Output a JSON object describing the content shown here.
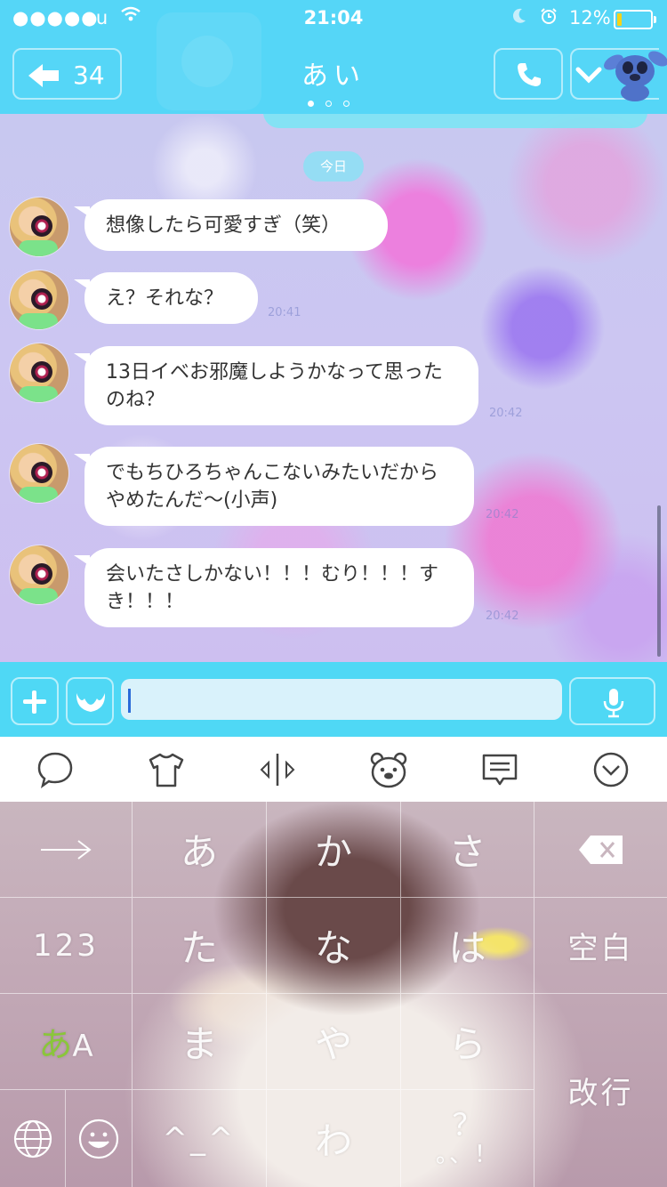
{
  "status_bar": {
    "signal": "●●●●●",
    "carrier": "au",
    "time": "21:04",
    "battery_percent": "12%",
    "battery_level": 0.12,
    "battery_color": "#f5d21a"
  },
  "header": {
    "back_count": "34",
    "title": "あい",
    "page_dots": 3,
    "active_dot": 0,
    "background": "#55d6f7"
  },
  "chat": {
    "date_label": "今日",
    "messages": [
      {
        "text": "想像したら可愛すぎ（笑）",
        "time": ""
      },
      {
        "text": "え？それな？",
        "time": "20:41"
      },
      {
        "text": "13日イベお邪魔しようかなって思ったのね？",
        "time": "20:42"
      },
      {
        "text": "でもちひろちゃんこないみたいだからやめたんだ〜(小声)",
        "time": "20:42"
      },
      {
        "text": "会いたさしかない！！！むり！！！すき！！！",
        "time": "20:42"
      }
    ]
  },
  "input_bar": {
    "placeholder": "",
    "value": ""
  },
  "keyboard_toolbar": {
    "icons": [
      "speech-bubble-icon",
      "tshirt-icon",
      "cursor-move-icon",
      "bear-face-icon",
      "message-icon",
      "collapse-keyboard-icon"
    ]
  },
  "keyboard": {
    "row1": [
      "→",
      "あ",
      "か",
      "さ",
      "⌫"
    ],
    "row2": [
      "123",
      "た",
      "な",
      "は",
      "空白"
    ],
    "row3": [
      "あ",
      "A",
      "ま",
      "や",
      "ら"
    ],
    "row4": [
      "🌐",
      "☺",
      "^_^",
      "わ",
      "？",
      "。、！"
    ],
    "enter": "改行",
    "mode_accent": "#8ac63a"
  },
  "colors": {
    "accent": "#4fd8f5",
    "bubble": "#ffffff",
    "input_field": "#d9f2fb"
  }
}
